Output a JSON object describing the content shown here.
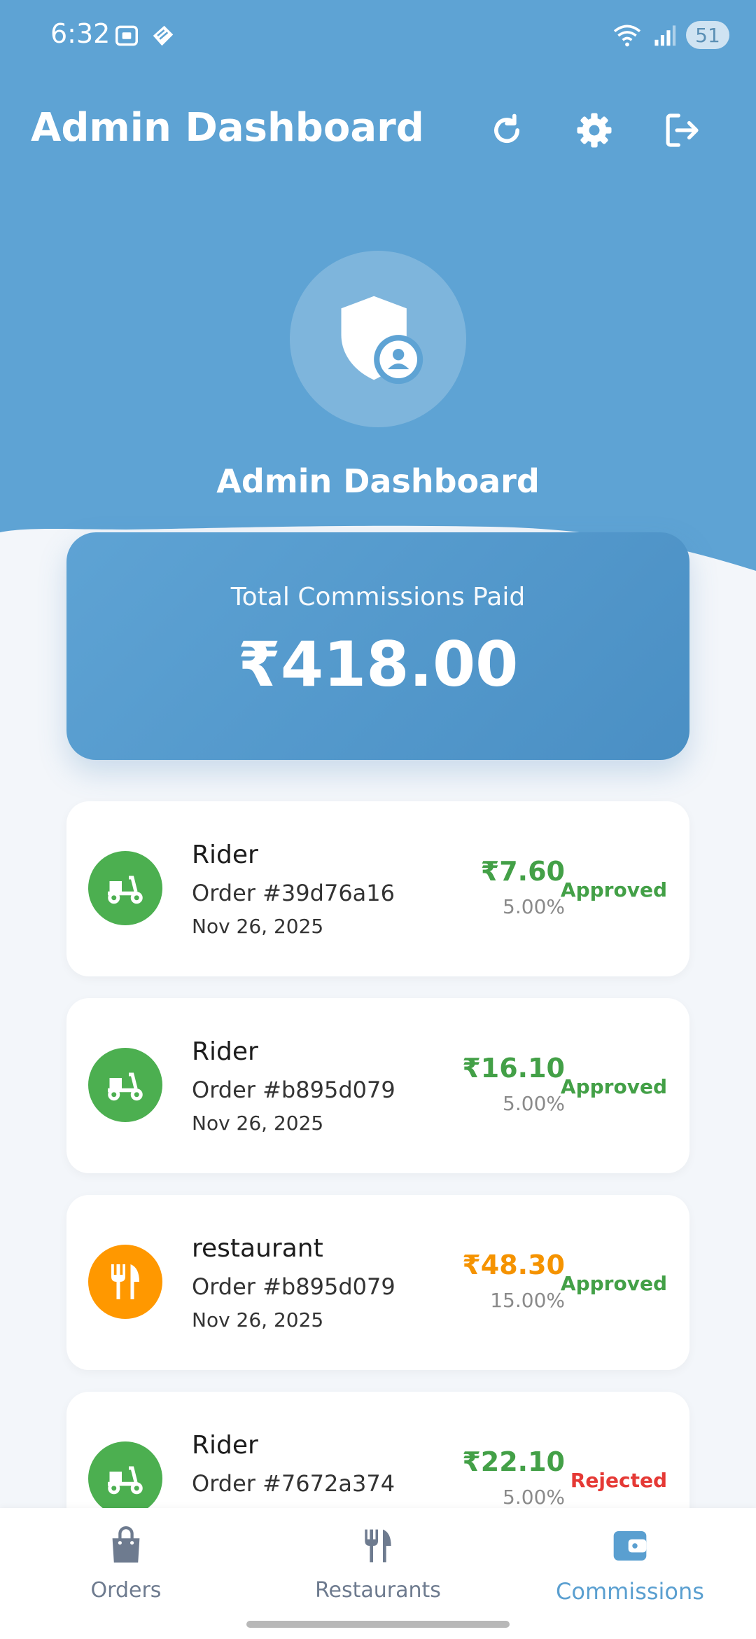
{
  "status_bar": {
    "time": "6:32",
    "battery": "51"
  },
  "app_bar": {
    "title": "Admin Dashboard",
    "actions": [
      "refresh-icon",
      "settings-icon",
      "logout-icon"
    ]
  },
  "header": {
    "title": "Admin Dashboard",
    "icon": "admin-shield-icon"
  },
  "summary": {
    "label": "Total Commissions Paid",
    "amount": "₹418.00"
  },
  "commissions": [
    {
      "role": "Rider",
      "order": "Order #39d76a16",
      "date": "Nov 26, 2025",
      "amount": "₹7.60",
      "percent": "5.00%",
      "status": "Approved",
      "icon": "scooter-icon",
      "icon_color": "#4caf50",
      "amount_color": "#43a047",
      "status_color": "#43a047"
    },
    {
      "role": "Rider",
      "order": "Order #b895d079",
      "date": "Nov 26, 2025",
      "amount": "₹16.10",
      "percent": "5.00%",
      "status": "Approved",
      "icon": "scooter-icon",
      "icon_color": "#4caf50",
      "amount_color": "#43a047",
      "status_color": "#43a047"
    },
    {
      "role": "restaurant",
      "order": "Order #b895d079",
      "date": "Nov 26, 2025",
      "amount": "₹48.30",
      "percent": "15.00%",
      "status": "Approved",
      "icon": "restaurant-icon",
      "icon_color": "#ff9800",
      "amount_color": "#f59300",
      "status_color": "#43a047"
    },
    {
      "role": "Rider",
      "order": "Order #7672a374",
      "date": "",
      "amount": "₹22.10",
      "percent": "5.00%",
      "status": "Rejected",
      "icon": "scooter-icon",
      "icon_color": "#4caf50",
      "amount_color": "#43a047",
      "status_color": "#e53935"
    }
  ],
  "bottom_nav": [
    {
      "label": "Orders",
      "icon": "shopping-bag-icon",
      "active": false
    },
    {
      "label": "Restaurants",
      "icon": "restaurant-icon",
      "active": false
    },
    {
      "label": "Commissions",
      "icon": "wallet-icon",
      "active": true
    }
  ],
  "colors": {
    "primary": "#5ea3d4",
    "background": "#f3f6fa"
  }
}
